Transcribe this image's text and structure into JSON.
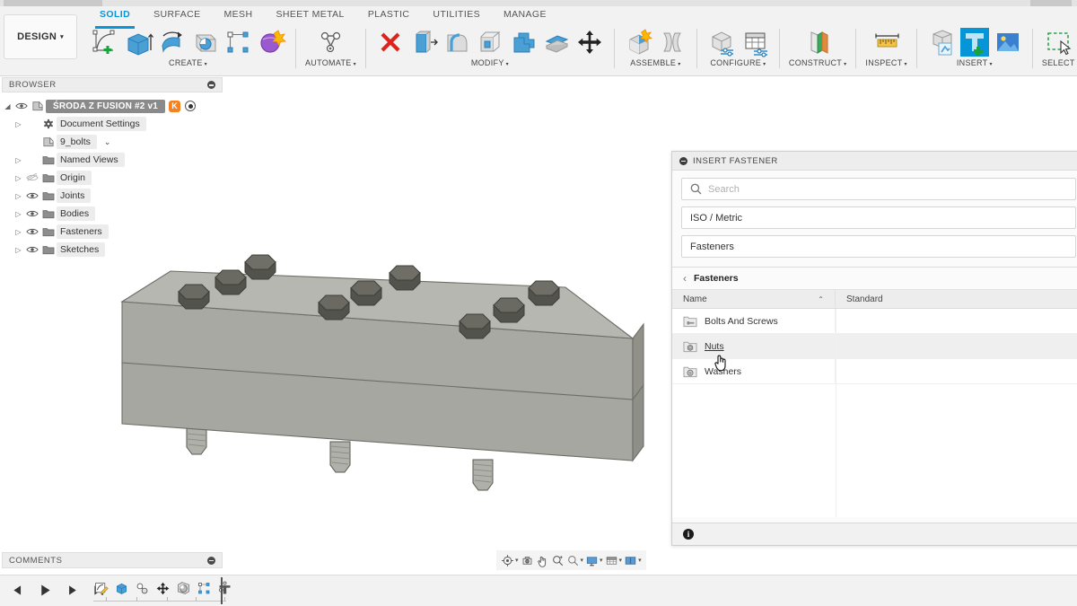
{
  "app": {
    "design_button": "DESIGN",
    "caret": "▾"
  },
  "ribbon": {
    "tabs": [
      {
        "label": "SOLID",
        "active": true
      },
      {
        "label": "SURFACE",
        "active": false
      },
      {
        "label": "MESH",
        "active": false
      },
      {
        "label": "SHEET METAL",
        "active": false
      },
      {
        "label": "PLASTIC",
        "active": false
      },
      {
        "label": "UTILITIES",
        "active": false
      },
      {
        "label": "MANAGE",
        "active": false
      }
    ],
    "groups": [
      {
        "label": "CREATE",
        "has_caret": true,
        "icons": [
          "create-sketch-icon",
          "extrude-icon",
          "revolve-icon",
          "sweep-icon",
          "pattern-icon",
          "form-icon"
        ]
      },
      {
        "label": "AUTOMATE",
        "has_caret": true,
        "icons": [
          "automate-icon"
        ]
      },
      {
        "label": "MODIFY",
        "has_caret": true,
        "icons": [
          "delete-icon",
          "press-pull-icon",
          "fillet-icon",
          "shell-icon",
          "combine-icon",
          "split-face-icon",
          "move-copy-icon"
        ]
      },
      {
        "label": "ASSEMBLE",
        "has_caret": true,
        "icons": [
          "new-component-icon",
          "joint-icon"
        ]
      },
      {
        "label": "CONFIGURE",
        "has_caret": true,
        "icons": [
          "configure-icon",
          "configure-table-icon"
        ]
      },
      {
        "label": "CONSTRUCT",
        "has_caret": true,
        "icons": [
          "construct-plane-icon"
        ]
      },
      {
        "label": "INSPECT",
        "has_caret": true,
        "icons": [
          "measure-icon"
        ]
      },
      {
        "label": "INSERT",
        "has_caret": true,
        "icons": [
          "insert-derive-icon",
          "insert-fastener-icon",
          "insert-canvas-icon"
        ]
      },
      {
        "label": "SELECT",
        "has_caret": false,
        "icons": [
          "select-window-icon"
        ]
      }
    ]
  },
  "browser": {
    "panel_title": "BROWSER",
    "collapse_icon": "collapse-icon",
    "tree": [
      {
        "label": "ŚRODA Z FUSION #2 v1",
        "root": true,
        "arrow": "◢",
        "eye": "eye-icon",
        "icon": "component-icon",
        "badge": "K",
        "radio": true
      },
      {
        "label": "Document Settings",
        "arrow": "▷",
        "eye": "",
        "icon": "gear-icon"
      },
      {
        "label": "9_bolts",
        "arrow": "",
        "eye": "",
        "icon": "component-icon",
        "chevron": "⌄"
      },
      {
        "label": "Named Views",
        "arrow": "▷",
        "eye": "",
        "icon": "folder-icon"
      },
      {
        "label": "Origin",
        "arrow": "▷",
        "eye": "eye-hidden-icon",
        "icon": "folder-icon"
      },
      {
        "label": "Joints",
        "arrow": "▷",
        "eye": "eye-icon",
        "icon": "folder-icon"
      },
      {
        "label": "Bodies",
        "arrow": "▷",
        "eye": "eye-icon",
        "icon": "folder-icon"
      },
      {
        "label": "Fasteners",
        "arrow": "▷",
        "eye": "eye-icon",
        "icon": "folder-icon"
      },
      {
        "label": "Sketches",
        "arrow": "▷",
        "eye": "eye-icon",
        "icon": "folder-icon"
      }
    ]
  },
  "fastener_panel": {
    "title": "INSERT FASTENER",
    "search_placeholder": "Search",
    "standard_value": "ISO / Metric",
    "category_value": "Fasteners",
    "breadcrumb": "Fasteners",
    "back_arrow": "‹",
    "columns": [
      "Name",
      "Standard"
    ],
    "sort_arrow": "⌃",
    "rows": [
      {
        "name": "Bolts And Screws",
        "standard": "",
        "icon": "bolt-folder-icon",
        "hovered": false
      },
      {
        "name": "Nuts",
        "standard": "",
        "icon": "nut-folder-icon",
        "hovered": true
      },
      {
        "name": "Washers",
        "standard": "",
        "icon": "washer-folder-icon",
        "hovered": false
      }
    ],
    "footer_icon": "info-icon"
  },
  "navbar": {
    "items": [
      {
        "name": "orbit-icon",
        "caret": "▾"
      },
      {
        "name": "look-at-icon",
        "caret": ""
      },
      {
        "name": "pan-icon",
        "caret": ""
      },
      {
        "name": "zoom-icon",
        "caret": ""
      },
      {
        "name": "zoom-window-icon",
        "caret": "▾"
      },
      {
        "name": "display-settings-icon",
        "caret": "▾"
      },
      {
        "name": "grid-snap-icon",
        "caret": "▾"
      },
      {
        "name": "viewports-icon",
        "caret": "▾"
      }
    ]
  },
  "comments": {
    "panel_title": "COMMENTS",
    "collapse_icon": "collapse-icon"
  },
  "timeline": {
    "playback": [
      "step-back-icon",
      "play-icon",
      "step-forward-icon",
      "skip-end-icon"
    ],
    "features": [
      "sketch-feature-icon",
      "extrude-feature-icon",
      "joint-feature-icon",
      "move-feature-icon",
      "revolve-feature-icon",
      "pattern-feature-icon",
      "fastener-feature-icon"
    ]
  },
  "colors": {
    "accent": "#0696d7",
    "ribbon_bg": "#f2f2f2",
    "canvas_bg": "#ffffff",
    "model_body": "#a8a8a4",
    "model_top": "#b9b9b4",
    "bolt_head": "#5b5b56",
    "root_node": "#8a8a8a",
    "badge": "#f5821f"
  }
}
